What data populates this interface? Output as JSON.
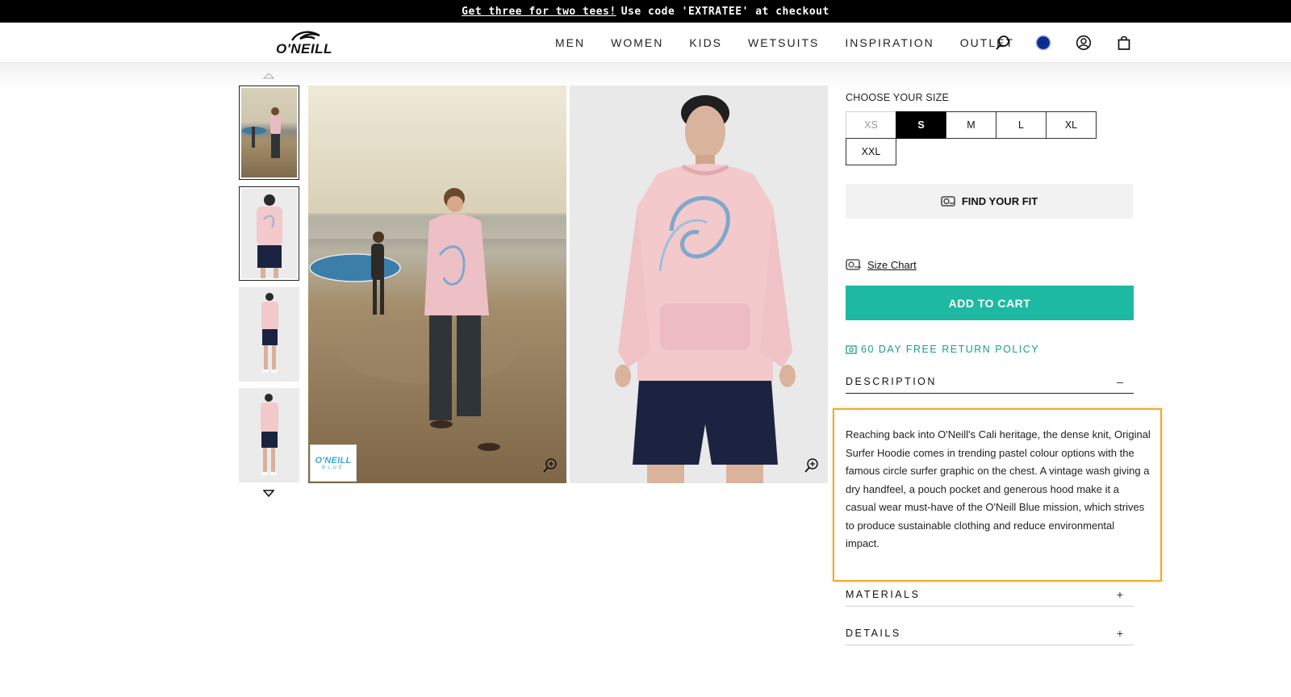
{
  "promo": {
    "link_text": "Get three for two tees!",
    "text": "Use code 'EXTRATEE' at checkout"
  },
  "header": {
    "logo_text": "O'NEILL",
    "nav": [
      "MEN",
      "WOMEN",
      "KIDS",
      "WETSUITS",
      "INSPIRATION",
      "OUTLET"
    ],
    "icons": [
      "search-icon",
      "region-icon",
      "account-icon",
      "cart-icon"
    ]
  },
  "gallery": {
    "badge_title": "O'NEILL",
    "badge_sub": "BLUE",
    "thumbnails": [
      "beach-surfer",
      "studio-front",
      "studio-full",
      "studio-back"
    ]
  },
  "product": {
    "size_title": "CHOOSE YOUR SIZE",
    "sizes": [
      {
        "label": "XS",
        "state": "disabled"
      },
      {
        "label": "S",
        "state": "selected"
      },
      {
        "label": "M",
        "state": "available"
      },
      {
        "label": "L",
        "state": "available"
      },
      {
        "label": "XL",
        "state": "available"
      },
      {
        "label": "XXL",
        "state": "available"
      }
    ],
    "find_fit_label": "FIND YOUR FIT",
    "size_chart_label": "Size Chart",
    "add_to_cart_label": "ADD TO CART",
    "returns_label": "60 DAY FREE RETURN POLICY"
  },
  "accordion": {
    "description": {
      "title": "DESCRIPTION",
      "toggle": "–",
      "text": "Reaching back into O'Neill's Cali heritage, the dense knit, Original Surfer Hoodie comes in trending pastel colour options with the famous circle surfer graphic on the chest. A vintage wash giving a dry handfeel, a pouch pocket and generous hood make it a casual wear must-have of the O'Neill Blue mission, which strives to produce sustainable clothing and reduce environmental impact."
    },
    "materials": {
      "title": "MATERIALS",
      "toggle": "+"
    },
    "details": {
      "title": "DETAILS",
      "toggle": "+"
    }
  },
  "colors": {
    "accent": "#1db9a3",
    "highlight": "#f0a92a",
    "hoodie": "#f3c9cc",
    "shorts": "#1c2340"
  }
}
